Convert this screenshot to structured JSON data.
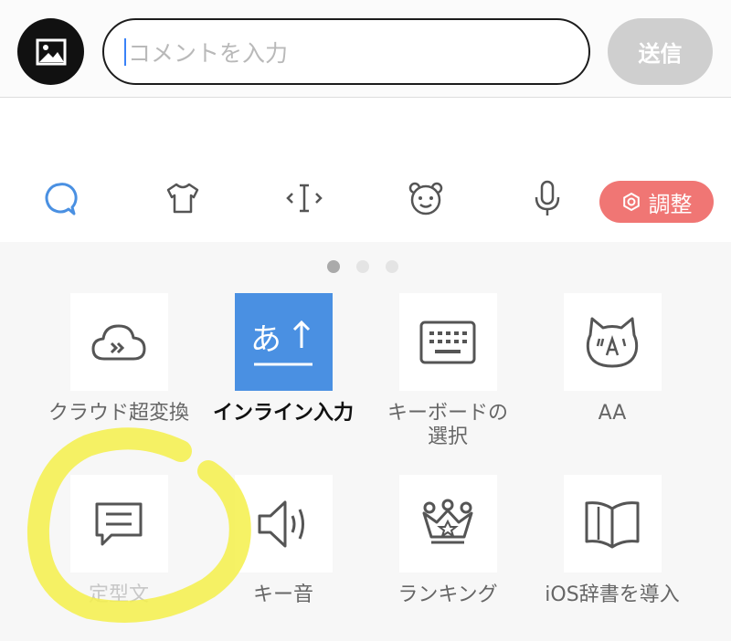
{
  "comment_bar": {
    "input_placeholder": "コメントを入力",
    "send_label": "送信"
  },
  "toolbar": {
    "icons": [
      "search-bubble-icon",
      "tshirt-icon",
      "cursor-move-icon",
      "bear-face-icon",
      "microphone-icon"
    ],
    "adjust_label": "調整",
    "adjust_icon": "gear-icon",
    "accent_color": "#f07674",
    "primary_color": "#4a90e2"
  },
  "pager": {
    "total": 3,
    "active": 1
  },
  "grid": {
    "items": [
      {
        "label": "クラウド超変換",
        "icon": "cloud-convert-icon"
      },
      {
        "label": "インライン入力",
        "icon": "inline-input-icon"
      },
      {
        "label_line1": "キーボードの",
        "label_line2": "選択",
        "icon": "keyboard-icon"
      },
      {
        "label": "AA",
        "icon": "cat-face-icon"
      },
      {
        "label": "定型文",
        "icon": "speech-bubble-icon"
      },
      {
        "label": "キー音",
        "icon": "speaker-icon"
      },
      {
        "label": "ランキング",
        "icon": "crown-icon"
      },
      {
        "label": "iOS辞書を導入",
        "icon": "book-icon"
      }
    ]
  },
  "highlight_color": "#f4f04a"
}
